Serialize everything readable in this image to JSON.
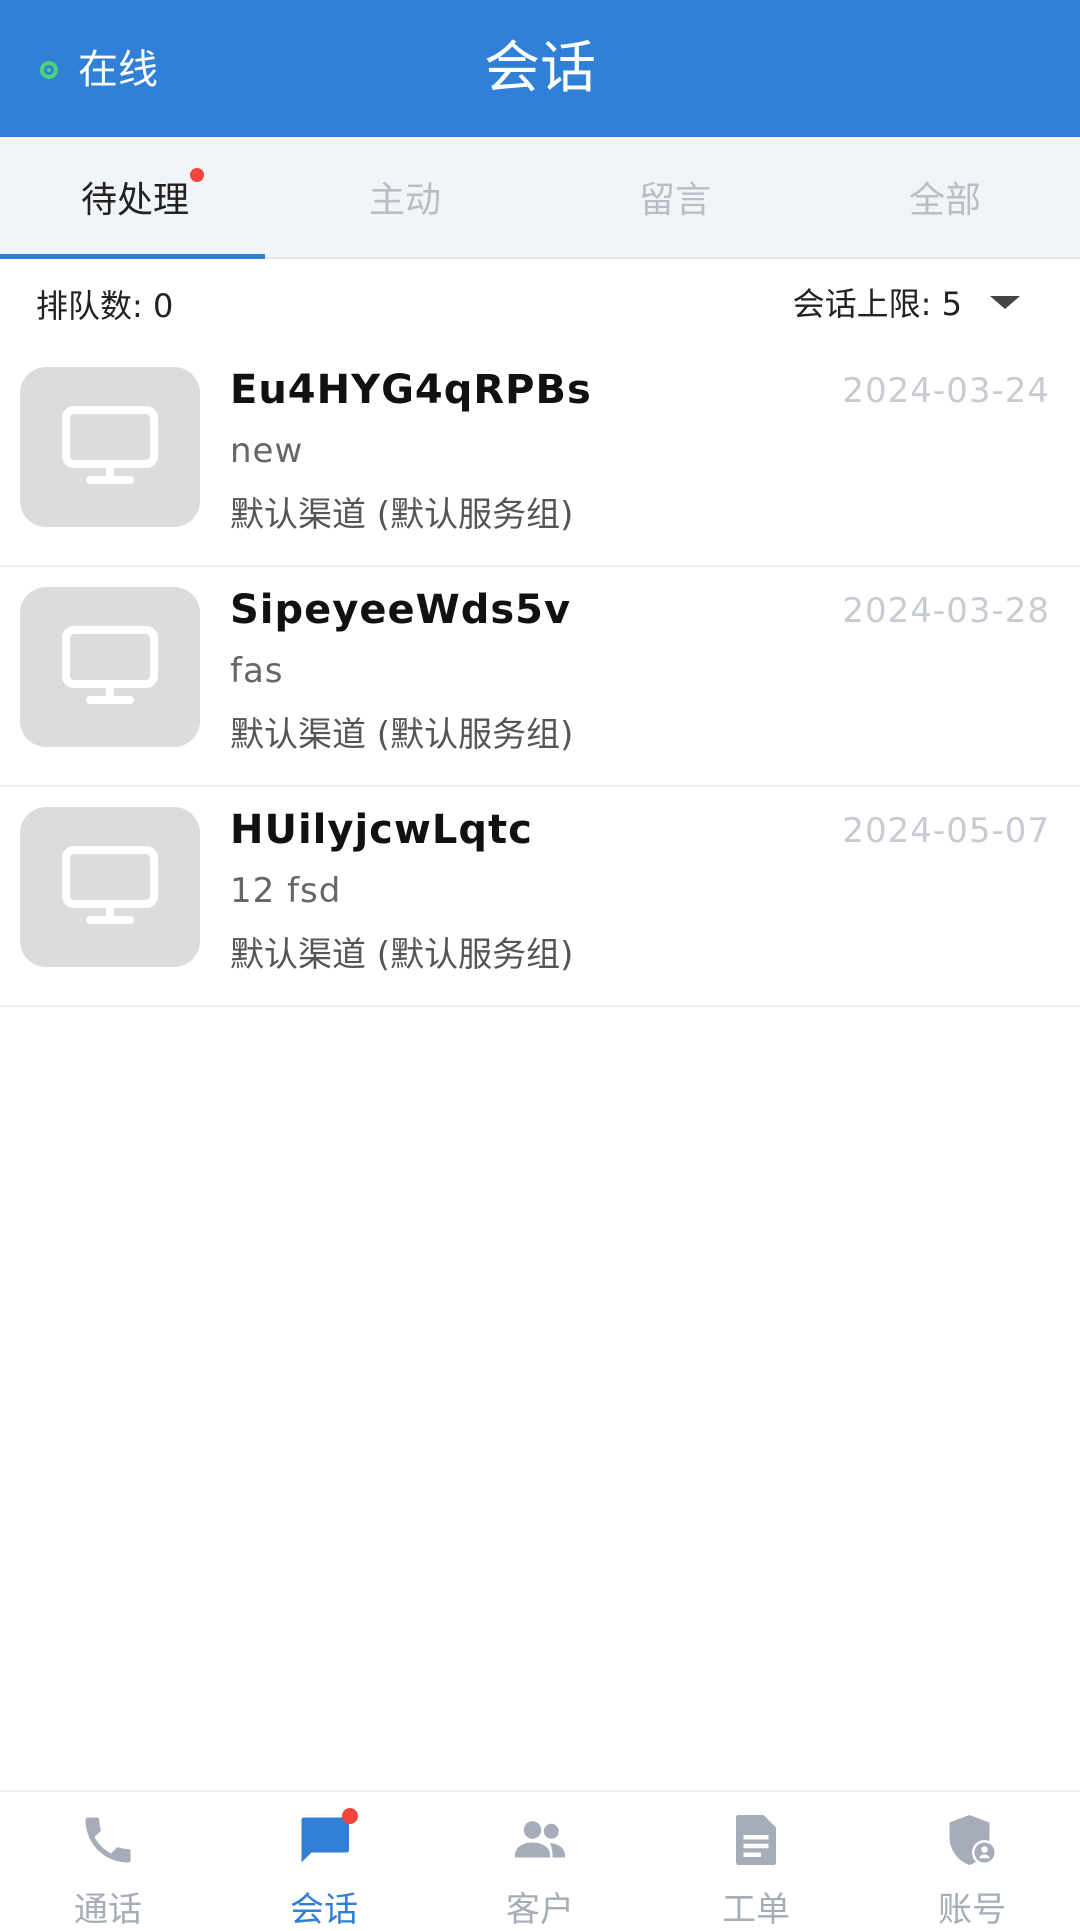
{
  "header": {
    "status_label": "在线",
    "title": "会话"
  },
  "tabs": [
    {
      "label": "待处理",
      "active": true,
      "badge": true
    },
    {
      "label": "主动",
      "active": false
    },
    {
      "label": "留言",
      "active": false
    },
    {
      "label": "全部",
      "active": false
    }
  ],
  "queue": {
    "count_label": "排队数: 0",
    "limit_label": "会话上限: 5"
  },
  "sessions": [
    {
      "name": "Eu4HYG4qRPBs",
      "date": "2024-03-24",
      "message": "new",
      "channel": "默认渠道 (默认服务组)"
    },
    {
      "name": "SipeyeeWds5v",
      "date": "2024-03-28",
      "message": "fas",
      "channel": "默认渠道 (默认服务组)"
    },
    {
      "name": "HUilyjcwLqtc",
      "date": "2024-05-07",
      "message": "12 fsd",
      "channel": "默认渠道 (默认服务组)"
    }
  ],
  "bottom_nav": [
    {
      "label": "通话",
      "icon": "phone-icon",
      "active": false
    },
    {
      "label": "会话",
      "icon": "chat-icon",
      "active": true,
      "badge": true
    },
    {
      "label": "客户",
      "icon": "users-icon",
      "active": false
    },
    {
      "label": "工单",
      "icon": "ticket-icon",
      "active": false
    },
    {
      "label": "账号",
      "icon": "account-shield-icon",
      "active": false
    }
  ],
  "colors": {
    "primary": "#2f80d6",
    "online": "#4cd47a",
    "badge": "#f2453d",
    "inactive": "#a6adb8"
  }
}
